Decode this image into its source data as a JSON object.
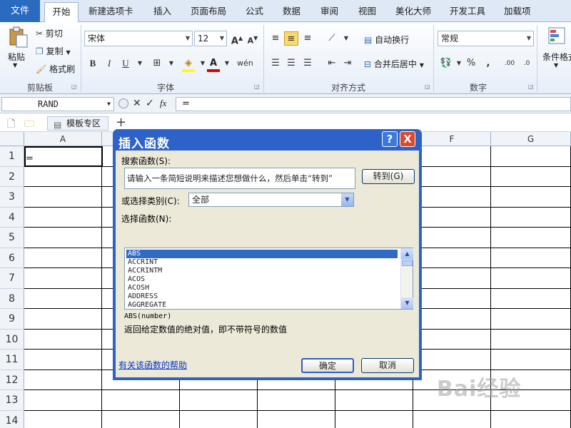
{
  "ribbon_tabs": [
    "文件",
    "开始",
    "新建选项卡",
    "插入",
    "页面布局",
    "公式",
    "数据",
    "审阅",
    "视图",
    "美化大师",
    "开发工具",
    "加载项"
  ],
  "clipboard": {
    "paste": "粘贴",
    "cut": "剪切",
    "copy": "复制",
    "format_painter": "格式刷",
    "group": "剪贴板"
  },
  "font": {
    "name": "宋体",
    "size": "12",
    "bold": "B",
    "italic": "I",
    "underline": "U",
    "group": "字体"
  },
  "alignment": {
    "wrap": "自动换行",
    "merge": "合并后居中",
    "group": "对齐方式"
  },
  "number": {
    "format": "常规",
    "percent": "%",
    "group": "数字"
  },
  "styles": {
    "conditional": "条件格式"
  },
  "formula_bar": {
    "name_box": "RAND",
    "fx": "fx",
    "content": "="
  },
  "sheet_tabs": {
    "template": "模板专区",
    "add": "+"
  },
  "columns": [
    "A",
    "F",
    "G"
  ],
  "rows": [
    "1",
    "2",
    "3",
    "4",
    "5",
    "6",
    "7",
    "8",
    "9",
    "10",
    "11",
    "12",
    "13",
    "14"
  ],
  "cell_A1": "=",
  "dialog": {
    "title": "插入函数",
    "help_btn": "?",
    "close_btn": "X",
    "search_label": "搜索函数(S):",
    "search_value": "请输入一条简短说明来描述您想做什么，然后单击“转到”",
    "go_button": "转到(G)",
    "category_label": "或选择类别(C):",
    "category_value": "全部",
    "select_label": "选择函数(N):",
    "functions": [
      "ABS",
      "ACCRINT",
      "ACCRINTM",
      "ACOS",
      "ACOSH",
      "ADDRESS",
      "AGGREGATE"
    ],
    "signature": "ABS(number)",
    "description": "返回给定数值的绝对值，即不带符号的数值",
    "help_link": "有关该函数的帮助",
    "ok": "确定",
    "cancel": "取消"
  },
  "watermark": "Bai经验"
}
